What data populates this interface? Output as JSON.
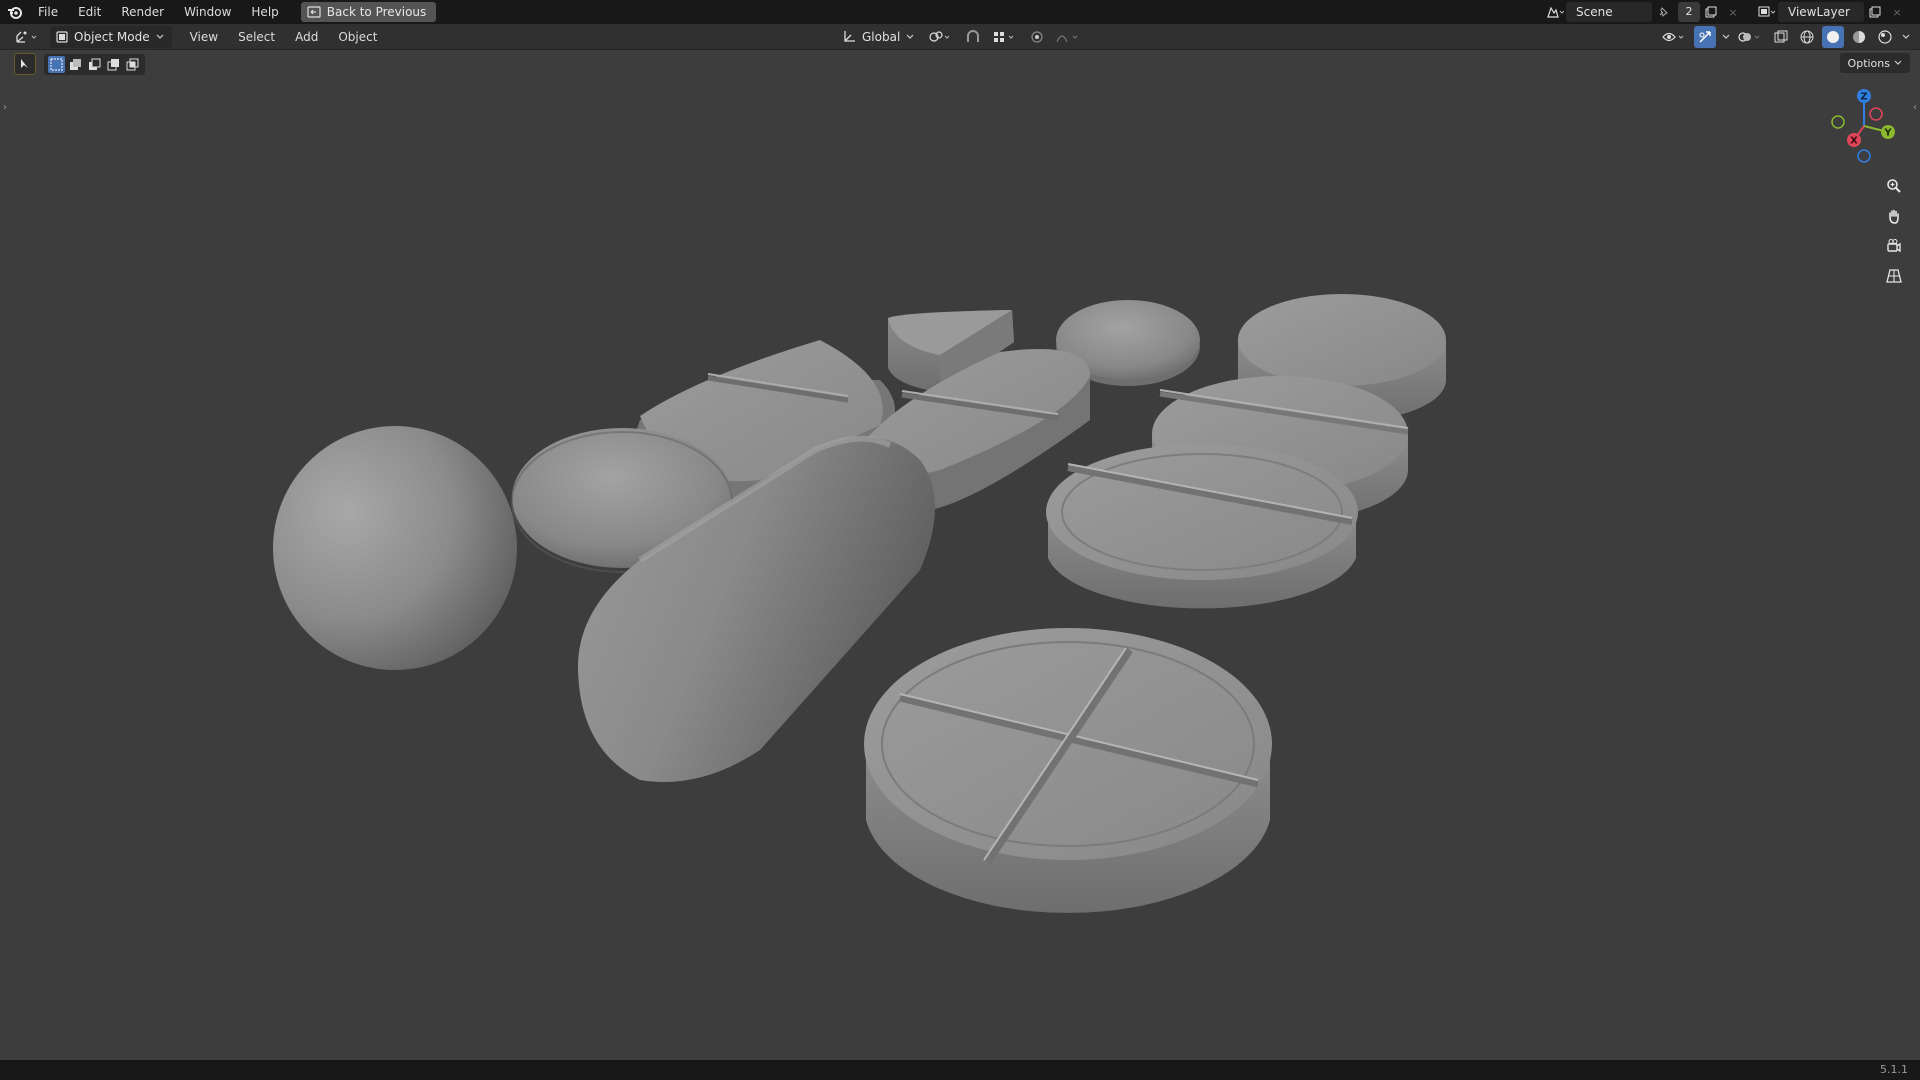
{
  "topbar": {
    "menu": [
      "File",
      "Edit",
      "Render",
      "Window",
      "Help"
    ],
    "back_label": "Back to Previous",
    "scene_name": "Scene",
    "scene_users": "2",
    "view_layer": "ViewLayer"
  },
  "header": {
    "mode": "Object Mode",
    "menu": [
      "View",
      "Select",
      "Add",
      "Object"
    ],
    "orientation": "Global"
  },
  "toolbar": {
    "options_label": "Options"
  },
  "gizmo": {
    "x": "X",
    "y": "Y",
    "z": "Z"
  },
  "status": {
    "version": "5.1.1"
  },
  "colors": {
    "accent": "#4772b3",
    "x_axis": "#e0465a",
    "y_axis": "#8ab82f",
    "z_axis": "#2f7ee0"
  }
}
